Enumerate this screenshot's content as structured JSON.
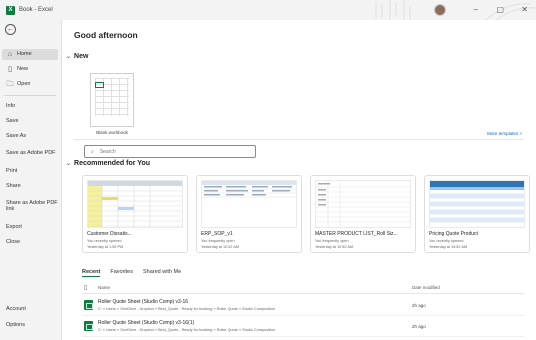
{
  "titlebar": {
    "app": "Book - Excel",
    "logo_letter": "X"
  },
  "sidebar": {
    "back": "←",
    "primary": [
      {
        "label": "Home",
        "icon": "⌂"
      },
      {
        "label": "New",
        "icon": "▯"
      },
      {
        "label": "Open",
        "icon": "🗀"
      }
    ],
    "secondary": [
      "Info",
      "Save",
      "Save As",
      "Save as Adobe PDF",
      "Print",
      "Share",
      "Share as Adobe PDF link",
      "Export",
      "Close"
    ],
    "bottom": [
      "Account",
      "Options"
    ]
  },
  "main": {
    "greeting": "Good afternoon",
    "new_section": "New",
    "blank_workbook": "Blank workbook",
    "more_templates": "More templates >",
    "search_placeholder": "Search",
    "recommended_title": "Recommended for You",
    "recommended": [
      {
        "name": "Customer Dissatis...",
        "who": "You recently opened",
        "when": "Yesterday at 1:59 PM"
      },
      {
        "name": "ERP_SOP_v1",
        "who": "You frequently open",
        "when": "Yesterday at 10:52 AM"
      },
      {
        "name": "MASTER PRODUCT LIST_Roll Siz...",
        "who": "You frequently open",
        "when": "Yesterday at 10:52 AM"
      },
      {
        "name": "Pricing Quote Product",
        "who": "You recently opened",
        "when": "Yesterday at 10:52 AM"
      }
    ],
    "tabs": [
      "Recent",
      "Favorites",
      "Shared with Me"
    ],
    "list_headers": {
      "name": "Name",
      "date": "Date modified"
    },
    "files": [
      {
        "name": "Roller Quote Sheet (Studio Comp) v3-16",
        "path": "C: » Users » OneDrive - Dropbox » Bind_Quote - Ready for booking » Roller Quote » Studio Composition",
        "date": "2h ago"
      },
      {
        "name": "Roller Quote Sheet (Studio Comp) v3-16(1)",
        "path": "C: » Users » OneDrive - Dropbox » Bind_Quote - Ready for booking » Roller Quote » Studio Composition",
        "date": "2h ago"
      }
    ]
  },
  "colors": {
    "accent": "#107c41",
    "link": "#0f6cbd"
  }
}
